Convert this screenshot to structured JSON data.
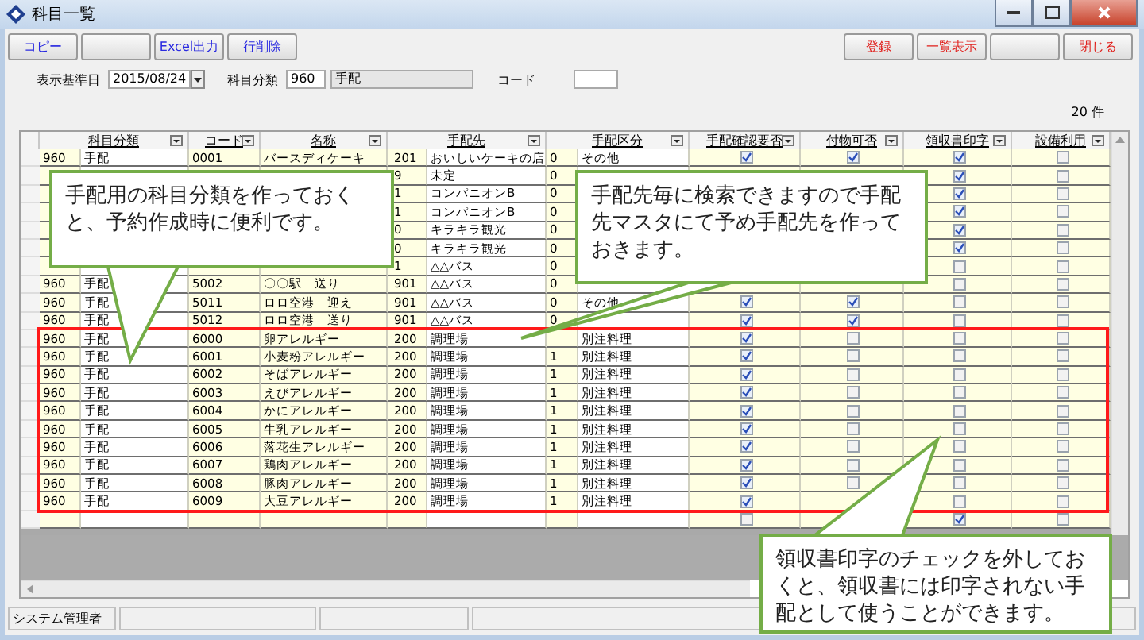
{
  "window": {
    "title": "科目一覧"
  },
  "toolbar": {
    "left": [
      {
        "kind": "text",
        "label": "コピー"
      },
      {
        "kind": "blank"
      },
      {
        "kind": "text",
        "label": "Excel出力"
      },
      {
        "kind": "text",
        "label": "行削除"
      }
    ],
    "right": [
      {
        "kind": "text",
        "label": "登録"
      },
      {
        "kind": "text",
        "label": "一覧表示"
      },
      {
        "kind": "blank"
      },
      {
        "kind": "text",
        "label": "閉じる"
      }
    ]
  },
  "filters": {
    "date_label": "表示基準日",
    "date": "2015/08/24",
    "category_label": "科目分類",
    "category_code": "960",
    "category_name": "手配",
    "code_label": "コード"
  },
  "count": "20 件",
  "table": {
    "columns": [
      {
        "label": "科目分類"
      },
      {
        "label": "コード"
      },
      {
        "label": "名称"
      },
      {
        "label": "手配先"
      },
      {
        "label": "手配区分"
      },
      {
        "label": "手配確認要否"
      },
      {
        "label": "付物可否"
      },
      {
        "label": "領収書印字"
      },
      {
        "label": "設備利用"
      }
    ],
    "rows": [
      {
        "category_code": "960",
        "category_name": "手配",
        "code": "0001",
        "name": "バースディケーキ",
        "vendor_code": "201",
        "vendor_name": "おいしいケーキの店",
        "type_code": "0",
        "type_name": "その他",
        "confirm_required": true,
        "extras_allowed": true,
        "receipt_print": true,
        "equipment_use": false
      },
      {
        "vendor_code": "9",
        "vendor_name": "未定",
        "type_code": "0",
        "receipt_print": true,
        "equipment_use": false
      },
      {
        "vendor_code": "1",
        "vendor_name": "コンパニオンB",
        "type_code": "0",
        "receipt_print": true,
        "equipment_use": false
      },
      {
        "vendor_code": "1",
        "vendor_name": "コンパニオンB",
        "type_code": "0",
        "receipt_print": true,
        "equipment_use": false
      },
      {
        "vendor_code": "0",
        "vendor_name": "キラキラ観光",
        "type_code": "0",
        "receipt_print": true,
        "equipment_use": false
      },
      {
        "vendor_code": "0",
        "vendor_name": "キラキラ観光",
        "type_code": "0",
        "receipt_print": true,
        "equipment_use": false
      },
      {
        "vendor_code": "1",
        "vendor_name": "△△バス",
        "type_code": "0",
        "receipt_print": false,
        "equipment_use": false
      },
      {
        "category_code": "960",
        "category_name": "手配",
        "code": "5002",
        "name": "〇〇駅　送り",
        "vendor_code": "901",
        "vendor_name": "△△バス",
        "type_code": "0",
        "receipt_print": false,
        "equipment_use": false
      },
      {
        "category_code": "960",
        "category_name": "手配",
        "code": "5011",
        "name": "ロロ空港　迎え",
        "vendor_code": "901",
        "vendor_name": "△△バス",
        "type_code": "0",
        "type_name": "その他",
        "confirm_required": true,
        "extras_allowed": true,
        "receipt_print": false,
        "equipment_use": false
      },
      {
        "category_code": "960",
        "category_name": "手配",
        "code": "5012",
        "name": "ロロ空港　送り",
        "vendor_code": "901",
        "vendor_name": "△△バス",
        "type_code": "0",
        "confirm_required": true,
        "extras_allowed": true,
        "receipt_print": false,
        "equipment_use": false
      },
      {
        "category_code": "960",
        "category_name": "手配",
        "code": "6000",
        "name": "卵アレルギー",
        "vendor_code": "200",
        "vendor_name": "調理場",
        "type_name": "別注料理",
        "confirm_required": true,
        "extras_allowed": false,
        "receipt_print": false,
        "equipment_use": false
      },
      {
        "category_code": "960",
        "category_name": "手配",
        "code": "6001",
        "name": "小麦粉アレルギー",
        "vendor_code": "200",
        "vendor_name": "調理場",
        "type_code": "1",
        "type_name": "別注料理",
        "confirm_required": true,
        "extras_allowed": false,
        "receipt_print": false,
        "equipment_use": false
      },
      {
        "category_code": "960",
        "category_name": "手配",
        "code": "6002",
        "name": "そばアレルギー",
        "vendor_code": "200",
        "vendor_name": "調理場",
        "type_code": "1",
        "type_name": "別注料理",
        "confirm_required": true,
        "extras_allowed": false,
        "receipt_print": false,
        "equipment_use": false
      },
      {
        "category_code": "960",
        "category_name": "手配",
        "code": "6003",
        "name": "えびアレルギー",
        "vendor_code": "200",
        "vendor_name": "調理場",
        "type_code": "1",
        "type_name": "別注料理",
        "confirm_required": true,
        "extras_allowed": false,
        "receipt_print": false,
        "equipment_use": false
      },
      {
        "category_code": "960",
        "category_name": "手配",
        "code": "6004",
        "name": "かにアレルギー",
        "vendor_code": "200",
        "vendor_name": "調理場",
        "type_code": "1",
        "type_name": "別注料理",
        "confirm_required": true,
        "extras_allowed": false,
        "receipt_print": false,
        "equipment_use": false
      },
      {
        "category_code": "960",
        "category_name": "手配",
        "code": "6005",
        "name": "牛乳アレルギー",
        "vendor_code": "200",
        "vendor_name": "調理場",
        "type_code": "1",
        "type_name": "別注料理",
        "confirm_required": true,
        "extras_allowed": false,
        "receipt_print": false,
        "equipment_use": false
      },
      {
        "category_code": "960",
        "category_name": "手配",
        "code": "6006",
        "name": "落花生アレルギー",
        "vendor_code": "200",
        "vendor_name": "調理場",
        "type_code": "1",
        "type_name": "別注料理",
        "confirm_required": true,
        "extras_allowed": false,
        "receipt_print": false,
        "equipment_use": false
      },
      {
        "category_code": "960",
        "category_name": "手配",
        "code": "6007",
        "name": "鶏肉アレルギー",
        "vendor_code": "200",
        "vendor_name": "調理場",
        "type_code": "1",
        "type_name": "別注料理",
        "confirm_required": true,
        "extras_allowed": false,
        "receipt_print": false,
        "equipment_use": false
      },
      {
        "category_code": "960",
        "category_name": "手配",
        "code": "6008",
        "name": "豚肉アレルギー",
        "vendor_code": "200",
        "vendor_name": "調理場",
        "type_code": "1",
        "type_name": "別注料理",
        "confirm_required": true,
        "extras_allowed": false,
        "receipt_print": false,
        "equipment_use": false
      },
      {
        "category_code": "960",
        "category_name": "手配",
        "code": "6009",
        "name": "大豆アレルギー",
        "vendor_code": "200",
        "vendor_name": "調理場",
        "type_code": "1",
        "type_name": "別注料理",
        "confirm_required": true,
        "receipt_print": false,
        "equipment_use": false
      },
      {
        "confirm_required": false,
        "receipt_print": true,
        "equipment_use": false
      }
    ]
  },
  "callouts": [
    {
      "text": "手配用の科目分類を作っておくと、予約作成時に便利です。"
    },
    {
      "text": "手配先毎に検索できますので手配先マスタにて予め手配先を作っておきます。"
    },
    {
      "text": "領収書印字のチェックを外しておくと、領収書には印字されない手配として使うことができます。"
    }
  ],
  "status_bar": [
    "システム管理者"
  ]
}
